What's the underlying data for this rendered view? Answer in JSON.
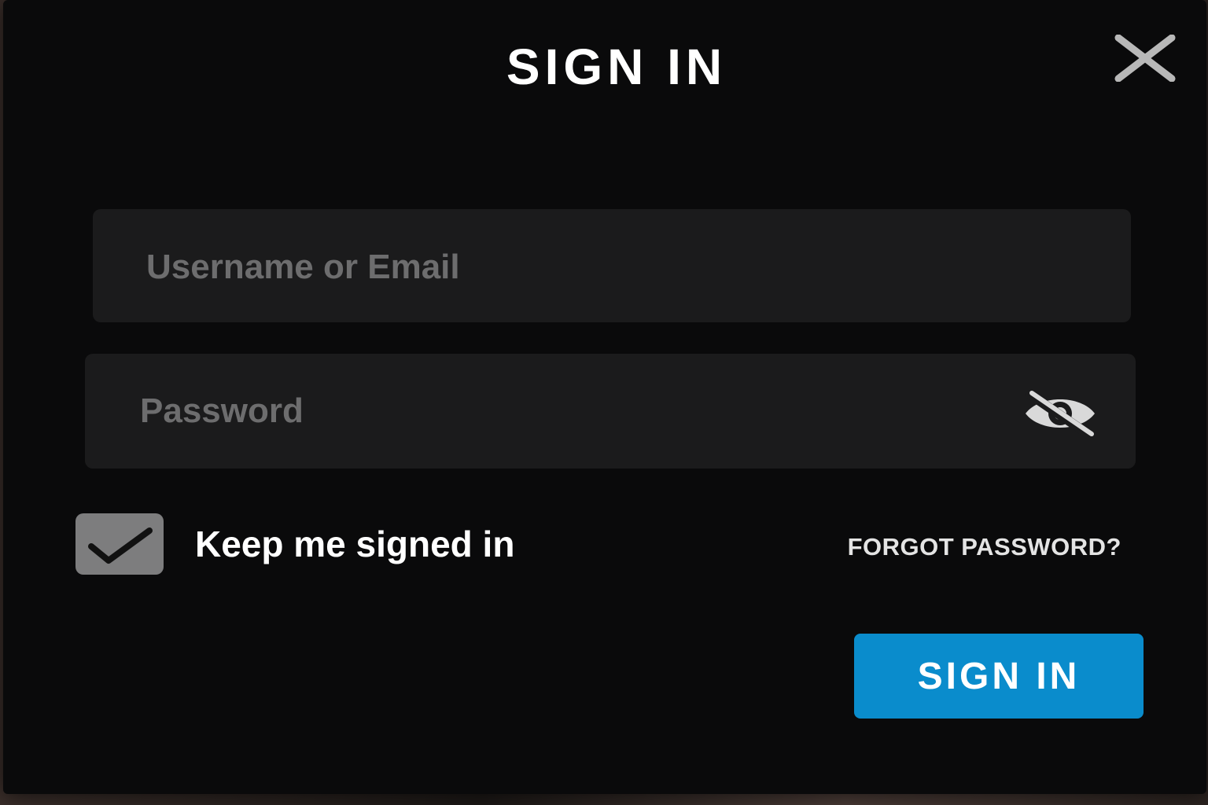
{
  "dialog": {
    "title": "SIGN IN",
    "close_icon": "close-icon"
  },
  "form": {
    "username": {
      "placeholder": "Username or Email",
      "value": ""
    },
    "password": {
      "placeholder": "Password",
      "value": "",
      "toggle_icon": "eye-off-icon"
    },
    "keep_signed_in": {
      "label": "Keep me signed in",
      "checked": true,
      "icon": "checkmark-icon"
    },
    "forgot_password_label": "FORGOT PASSWORD?",
    "submit_label": "SIGN IN"
  },
  "colors": {
    "background": "#0a0a0b",
    "field_background": "#1b1b1c",
    "checkbox_background": "#7d7d7e",
    "accent": "#0a8ccc",
    "text": "#ffffff"
  }
}
